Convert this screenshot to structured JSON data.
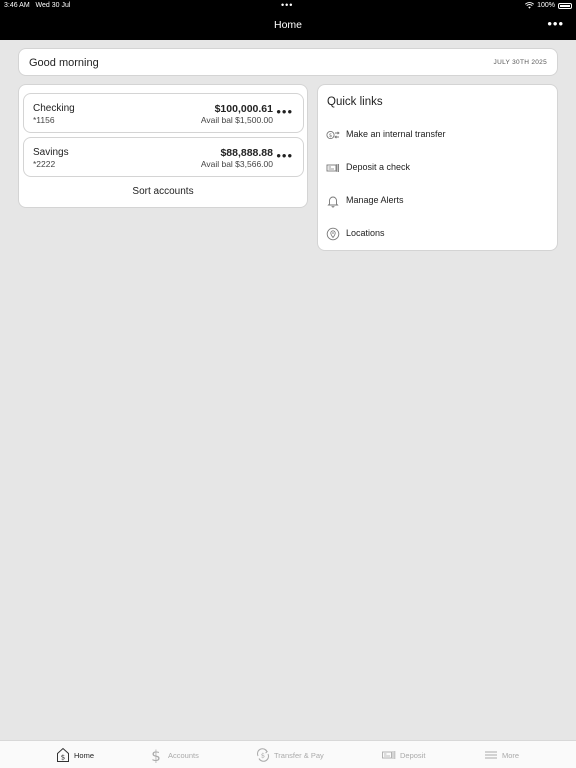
{
  "status": {
    "time": "3:46 AM",
    "date": "Wed 30 Jul",
    "battery": "100%"
  },
  "nav": {
    "title": "Home",
    "more": "•••"
  },
  "greeting": {
    "text": "Good morning",
    "date": "JULY 30TH 2025"
  },
  "accounts": [
    {
      "name": "Checking",
      "number": "*1156",
      "balance": "$100,000.61",
      "avail": "Avail bal $1,500.00"
    },
    {
      "name": "Savings",
      "number": "*2222",
      "balance": "$88,888.88",
      "avail": "Avail bal $3,566.00"
    }
  ],
  "account_more": "•••",
  "sort_label": "Sort accounts",
  "quick_links": {
    "title": "Quick links",
    "items": [
      {
        "label": "Make an internal transfer",
        "icon": "transfer-icon"
      },
      {
        "label": "Deposit a check",
        "icon": "check-deposit-icon"
      },
      {
        "label": "Manage Alerts",
        "icon": "bell-icon"
      },
      {
        "label": "Locations",
        "icon": "location-pin-icon"
      }
    ]
  },
  "tabs": [
    {
      "label": "Home",
      "icon": "home-dollar-icon",
      "active": true
    },
    {
      "label": "Accounts",
      "icon": "dollar-icon",
      "active": false
    },
    {
      "label": "Transfer & Pay",
      "icon": "transfer-pay-icon",
      "active": false
    },
    {
      "label": "Deposit",
      "icon": "check-deposit-icon",
      "active": false
    },
    {
      "label": "More",
      "icon": "menu-icon",
      "active": false
    }
  ],
  "colors": {
    "header": "#000000",
    "background": "#e6e6e6",
    "card": "#ffffff",
    "tab_inactive": "#aaaaaa"
  }
}
